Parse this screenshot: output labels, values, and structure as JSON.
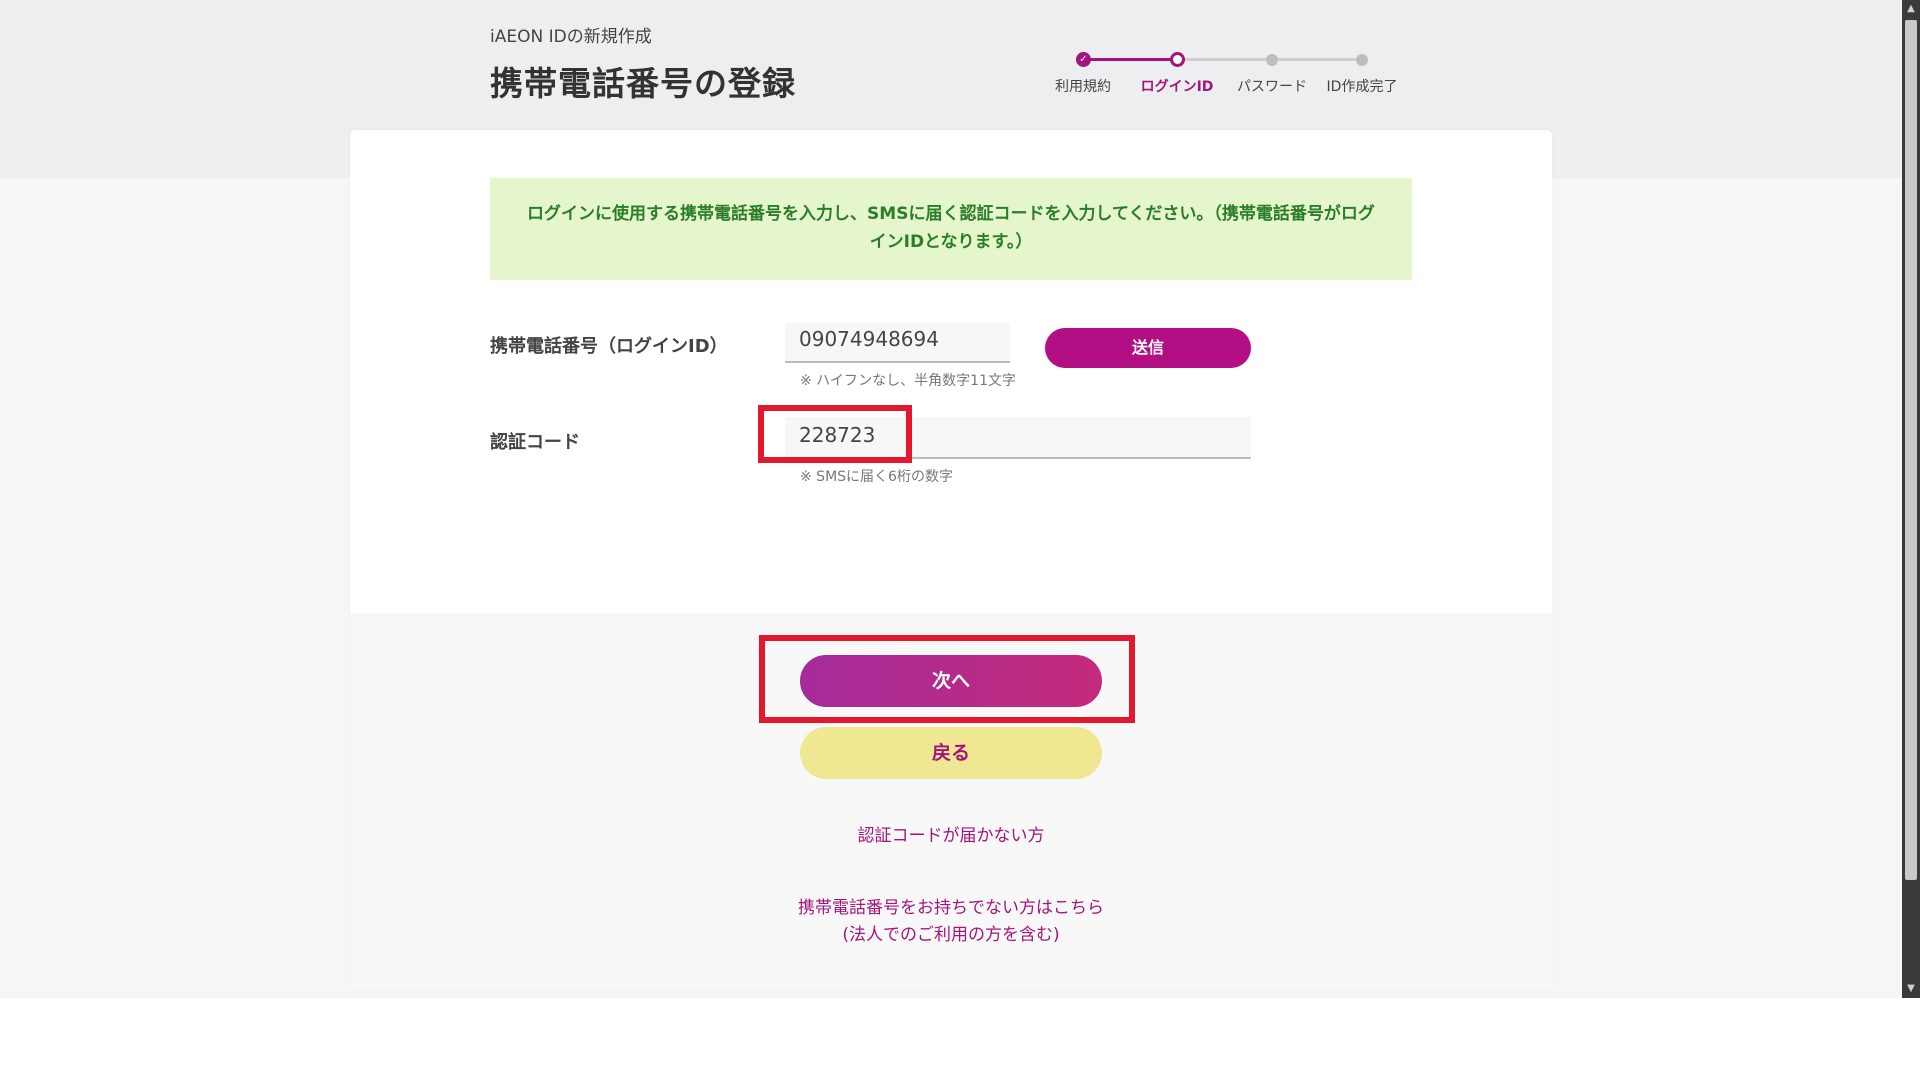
{
  "header": {
    "subtitle": "iAEON IDの新規作成",
    "title": "携帯電話番号の登録"
  },
  "stepper": {
    "steps": [
      {
        "label": "利用規約",
        "state": "done",
        "icon": "check-icon"
      },
      {
        "label": "ログインID",
        "state": "current"
      },
      {
        "label": "パスワード",
        "state": "todo"
      },
      {
        "label": "ID作成完了",
        "state": "todo"
      }
    ],
    "accent_color": "#a3157d"
  },
  "notice": {
    "text": "ログインに使用する携帯電話番号を入力し、SMSに届く認証コードを入力してください。（携帯電話番号がログインIDとなります。）"
  },
  "form": {
    "phone": {
      "label": "携帯電話番号（ログインID）",
      "value": "09074948694",
      "hint": "※ ハイフンなし、半角数字11文字"
    },
    "send_button_label": "送信",
    "code": {
      "label": "認証コード",
      "value": "228723",
      "hint": "※ SMSに届く6桁の数字"
    }
  },
  "actions": {
    "next_label": "次へ",
    "back_label": "戻る"
  },
  "links": {
    "code_not_received": "認証コードが届かない方",
    "no_phone_line1": "携帯電話番号をお持ちでない方はこちら",
    "no_phone_line2": "(法人でのご利用の方を含む)"
  },
  "colors": {
    "brand": "#b10f83",
    "notice_bg": "#e6f6cc",
    "notice_text": "#2b7d2b",
    "highlight": "#e3172e",
    "back_bg": "#efe791"
  }
}
